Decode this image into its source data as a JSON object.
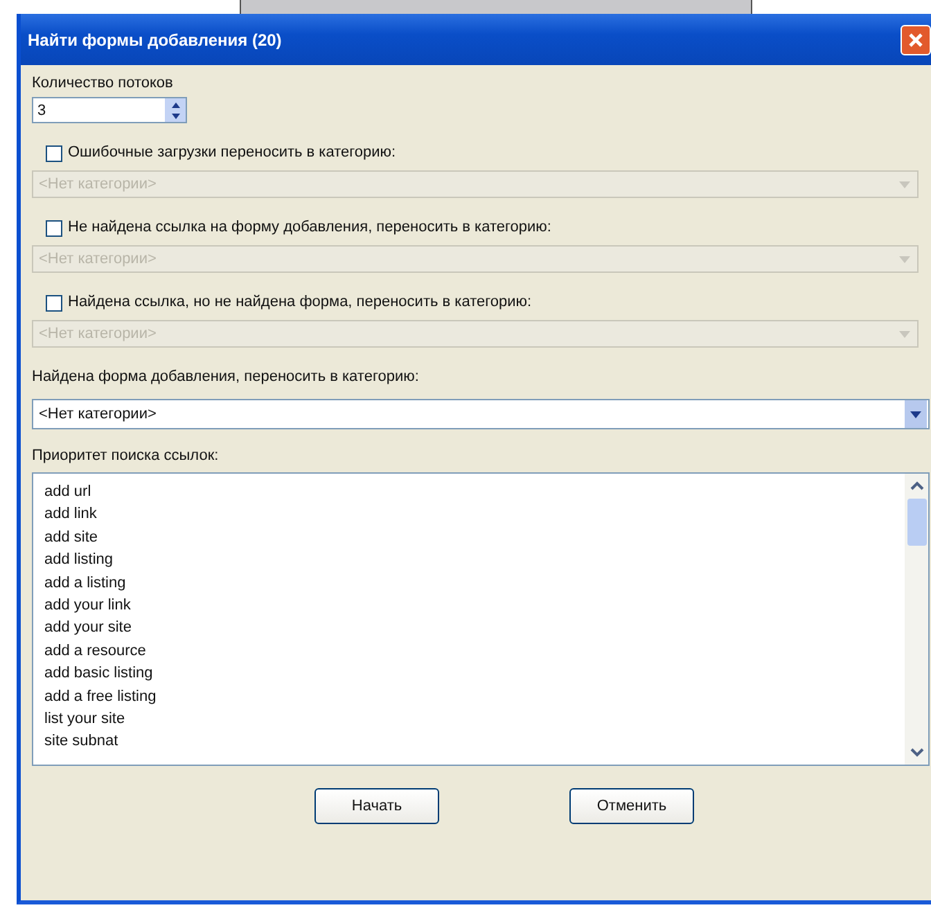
{
  "window": {
    "title": "Найти формы добавления (20)"
  },
  "threads": {
    "label": "Количество потоков",
    "value": "3"
  },
  "move_options": [
    {
      "label": "Ошибочные загрузки переносить в категорию:",
      "checked": false,
      "combo": {
        "value": "<Нет категории>",
        "disabled": true
      }
    },
    {
      "label": "Не найдена ссылка на форму добавления, переносить в категорию:",
      "checked": false,
      "combo": {
        "value": "<Нет категории>",
        "disabled": true
      }
    },
    {
      "label": "Найдена ссылка, но не найдена форма, переносить в категорию:",
      "checked": false,
      "combo": {
        "value": "<Нет категории>",
        "disabled": true
      }
    }
  ],
  "found_form": {
    "label": "Найдена форма добавления, переносить в категорию:",
    "combo": {
      "value": "<Нет категории>",
      "disabled": false
    }
  },
  "priority": {
    "label": "Приоритет поиска ссылок:",
    "items": [
      "add url",
      "add link",
      "add site",
      "add listing",
      "add a listing",
      "add your link",
      "add your site",
      "add a resource",
      "add basic listing",
      "add a free listing",
      "list your site",
      "site subnat"
    ]
  },
  "buttons": [
    "Начать",
    "Отменить"
  ]
}
